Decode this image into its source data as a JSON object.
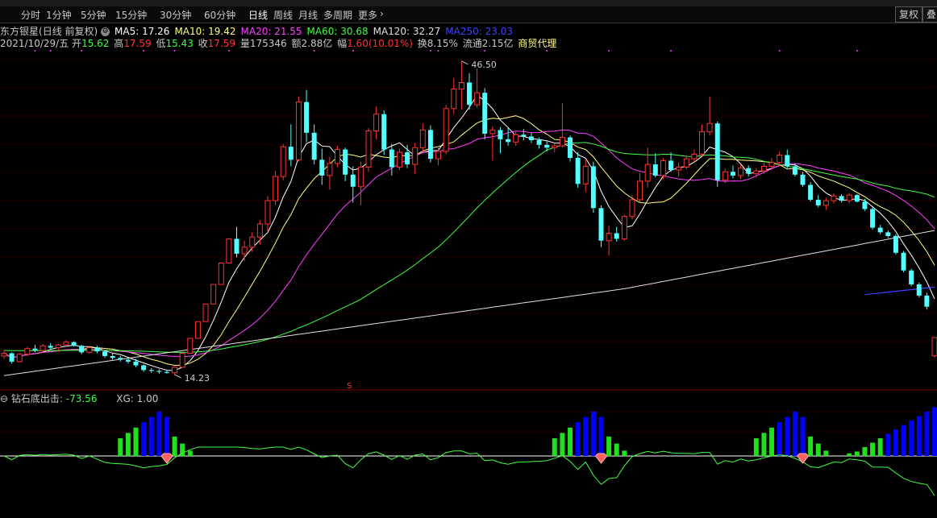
{
  "periods": [
    "分时",
    "1分钟",
    "5分钟",
    "15分钟",
    "30分钟",
    "60分钟",
    "日线",
    "周线",
    "月线",
    "多周期",
    "更多"
  ],
  "active_period": "日线",
  "more_arrow": "›",
  "right_buttons": {
    "fq": "复权",
    "overlay": "叠"
  },
  "stock": {
    "name": "东方银星",
    "mode": "(日线 前复权)"
  },
  "ma_labels": [
    {
      "text": "MA5: 17.26",
      "color": "#ffffff"
    },
    {
      "text": "MA10: 19.42",
      "color": "#ffff80"
    },
    {
      "text": "MA20: 21.55",
      "color": "#ff40ff"
    },
    {
      "text": "MA60: 30.68",
      "color": "#40ff40"
    },
    {
      "text": "MA120: 32.27",
      "color": "#e0e0e0"
    },
    {
      "text": "MA250: 23.03",
      "color": "#4040ff"
    }
  ],
  "ohlc": {
    "date": "2021/10/29/五",
    "open_label": "开",
    "open": "15.62",
    "high_label": "高",
    "high": "17.59",
    "low_label": "低",
    "low": "15.43",
    "close_label": "收",
    "close": "17.59",
    "vol_label": "量",
    "vol": "175346",
    "amt_label": "额",
    "amt": "2.88亿",
    "chg_label": "幅",
    "chg": "1.60(10.01%)",
    "turn_label": "换",
    "turn": "8.15%",
    "float_label": "流通",
    "float": "2.15亿",
    "industry": "商贸代理"
  },
  "annotations": {
    "high": "46.50",
    "low": "14.23",
    "s_marker": "S"
  },
  "sub": {
    "name": "钻石底出击",
    "value": ": -73.56",
    "xg": "XG: 1.00"
  },
  "colors": {
    "up": "#ff3232",
    "down": "#54ffff",
    "ma5": "#ffffff",
    "ma10": "#ffff80",
    "ma20": "#ff40ff",
    "ma60": "#40ff40",
    "ma120": "#e0e0e0",
    "ma250": "#4040ff"
  },
  "chart_data": {
    "type": "candlestick",
    "ylim": [
      13.0,
      48.5
    ],
    "candles": [
      [
        15.6,
        16.2,
        15.3,
        15.9
      ],
      [
        15.9,
        16.0,
        14.8,
        15.0
      ],
      [
        15.0,
        15.9,
        14.9,
        15.8
      ],
      [
        15.8,
        16.6,
        15.6,
        16.4
      ],
      [
        16.4,
        16.8,
        16.0,
        16.2
      ],
      [
        16.2,
        16.9,
        16.0,
        16.7
      ],
      [
        16.7,
        17.0,
        16.3,
        16.5
      ],
      [
        16.5,
        16.9,
        16.1,
        16.8
      ],
      [
        16.8,
        17.3,
        16.6,
        17.1
      ],
      [
        17.1,
        17.2,
        16.6,
        16.7
      ],
      [
        16.7,
        16.8,
        15.8,
        16.0
      ],
      [
        16.0,
        16.6,
        15.9,
        16.5
      ],
      [
        16.5,
        16.7,
        15.9,
        16.1
      ],
      [
        16.1,
        16.2,
        15.4,
        15.6
      ],
      [
        15.6,
        15.9,
        15.2,
        15.4
      ],
      [
        15.4,
        15.6,
        15.0,
        15.2
      ],
      [
        15.2,
        15.4,
        14.8,
        15.0
      ],
      [
        15.0,
        15.3,
        14.4,
        14.6
      ],
      [
        14.6,
        14.7,
        13.9,
        14.1
      ],
      [
        14.1,
        14.3,
        13.8,
        14.0
      ],
      [
        14.0,
        14.2,
        13.7,
        13.9
      ],
      [
        13.9,
        14.1,
        13.7,
        13.8
      ],
      [
        13.8,
        14.5,
        13.6,
        14.4
      ],
      [
        14.4,
        15.9,
        14.4,
        15.9
      ],
      [
        15.9,
        17.5,
        15.9,
        17.5
      ],
      [
        17.5,
        19.3,
        17.5,
        19.3
      ],
      [
        19.3,
        21.2,
        19.3,
        21.2
      ],
      [
        21.2,
        23.3,
        21.2,
        23.3
      ],
      [
        23.3,
        25.6,
        23.3,
        25.6
      ],
      [
        25.6,
        28.2,
        25.6,
        28.2
      ],
      [
        28.2,
        29.5,
        26.2,
        26.6
      ],
      [
        26.6,
        28.0,
        25.8,
        27.3
      ],
      [
        27.3,
        28.9,
        26.8,
        28.4
      ],
      [
        28.4,
        30.2,
        27.6,
        29.8
      ],
      [
        29.8,
        32.8,
        29.0,
        32.3
      ],
      [
        32.3,
        35.5,
        31.8,
        34.9
      ],
      [
        34.9,
        38.4,
        34.5,
        38.1
      ],
      [
        38.1,
        40.5,
        36.0,
        36.7
      ],
      [
        36.7,
        43.5,
        36.5,
        42.9
      ],
      [
        42.9,
        44.2,
        38.6,
        39.6
      ],
      [
        39.6,
        40.5,
        36.2,
        36.7
      ],
      [
        36.7,
        37.9,
        34.0,
        35.0
      ],
      [
        35.0,
        37.0,
        33.5,
        36.3
      ],
      [
        36.3,
        38.2,
        35.9,
        37.8
      ],
      [
        37.8,
        38.0,
        34.4,
        35.1
      ],
      [
        35.1,
        36.0,
        32.1,
        33.8
      ],
      [
        33.8,
        36.5,
        31.8,
        35.9
      ],
      [
        35.9,
        40.1,
        35.4,
        39.8
      ],
      [
        39.8,
        42.4,
        38.9,
        41.6
      ],
      [
        41.6,
        42.0,
        37.2,
        37.8
      ],
      [
        37.8,
        38.4,
        35.0,
        35.9
      ],
      [
        35.9,
        37.9,
        35.6,
        37.5
      ],
      [
        37.5,
        38.3,
        35.8,
        36.2
      ],
      [
        36.2,
        38.5,
        35.2,
        38.0
      ],
      [
        38.0,
        40.6,
        37.5,
        39.9
      ],
      [
        39.9,
        40.4,
        36.4,
        36.8
      ],
      [
        36.8,
        38.2,
        36.1,
        37.6
      ],
      [
        37.6,
        42.6,
        37.3,
        42.2
      ],
      [
        42.2,
        45.5,
        41.6,
        44.3
      ],
      [
        44.3,
        47.3,
        42.1,
        45.0
      ],
      [
        45.0,
        46.0,
        42.1,
        42.6
      ],
      [
        42.6,
        46.5,
        42.3,
        43.9
      ],
      [
        43.9,
        44.4,
        38.9,
        39.5
      ],
      [
        39.5,
        40.3,
        36.6,
        39.9
      ],
      [
        39.9,
        40.2,
        37.4,
        38.9
      ],
      [
        38.9,
        40.1,
        38.2,
        38.6
      ],
      [
        38.6,
        39.8,
        38.2,
        39.4
      ],
      [
        39.4,
        40.0,
        38.8,
        39.2
      ],
      [
        39.2,
        39.6,
        38.5,
        38.8
      ],
      [
        38.8,
        39.1,
        37.9,
        38.3
      ],
      [
        38.3,
        38.7,
        37.6,
        38.0
      ],
      [
        38.0,
        38.5,
        37.5,
        38.2
      ],
      [
        38.2,
        42.8,
        38.0,
        39.1
      ],
      [
        39.1,
        39.3,
        36.5,
        36.9
      ],
      [
        36.9,
        37.5,
        33.7,
        34.1
      ],
      [
        34.1,
        36.8,
        33.2,
        36.0
      ],
      [
        36.0,
        36.5,
        31.0,
        31.5
      ],
      [
        31.5,
        31.8,
        27.3,
        28.0
      ],
      [
        28.0,
        29.6,
        26.4,
        28.8
      ],
      [
        28.8,
        29.5,
        27.9,
        28.2
      ],
      [
        28.2,
        30.8,
        28.0,
        30.6
      ],
      [
        30.6,
        32.9,
        30.3,
        32.4
      ],
      [
        32.4,
        35.3,
        32.1,
        34.4
      ],
      [
        34.4,
        38.0,
        33.7,
        36.2
      ],
      [
        36.2,
        37.4,
        34.8,
        35.0
      ],
      [
        35.0,
        36.9,
        34.6,
        36.6
      ],
      [
        36.6,
        37.5,
        35.4,
        35.6
      ],
      [
        35.6,
        36.4,
        34.9,
        35.9
      ],
      [
        35.9,
        37.2,
        35.7,
        36.8
      ],
      [
        36.8,
        37.8,
        36.4,
        37.3
      ],
      [
        37.3,
        40.5,
        37.1,
        39.7
      ],
      [
        39.7,
        43.5,
        39.3,
        40.6
      ],
      [
        40.6,
        40.8,
        33.8,
        34.5
      ],
      [
        34.5,
        35.7,
        34.2,
        35.4
      ],
      [
        35.4,
        36.1,
        34.7,
        35.0
      ],
      [
        35.0,
        36.2,
        34.6,
        35.8
      ],
      [
        35.8,
        36.1,
        34.9,
        35.2
      ],
      [
        35.2,
        35.8,
        34.8,
        35.5
      ],
      [
        35.5,
        36.4,
        35.2,
        36.0
      ],
      [
        36.0,
        36.9,
        35.6,
        36.4
      ],
      [
        36.4,
        37.6,
        36.0,
        37.2
      ],
      [
        37.2,
        37.8,
        35.8,
        36.0
      ],
      [
        36.0,
        36.3,
        34.9,
        35.1
      ],
      [
        35.1,
        35.4,
        33.8,
        34.0
      ],
      [
        34.0,
        34.3,
        32.2,
        32.4
      ],
      [
        32.4,
        32.9,
        31.6,
        31.8
      ],
      [
        31.8,
        32.6,
        31.3,
        32.3
      ],
      [
        32.3,
        33.1,
        32.0,
        32.8
      ],
      [
        32.8,
        33.0,
        32.1,
        32.3
      ],
      [
        32.3,
        33.1,
        32.0,
        32.9
      ],
      [
        32.9,
        33.0,
        32.1,
        32.2
      ],
      [
        32.2,
        32.5,
        31.2,
        31.4
      ],
      [
        31.4,
        31.6,
        29.2,
        29.4
      ],
      [
        29.4,
        29.7,
        28.7,
        28.9
      ],
      [
        28.9,
        29.1,
        28.3,
        28.5
      ],
      [
        28.5,
        28.7,
        26.5,
        26.7
      ],
      [
        26.7,
        26.9,
        24.6,
        24.8
      ],
      [
        24.8,
        25.0,
        23.1,
        23.3
      ],
      [
        23.3,
        23.5,
        21.9,
        22.1
      ],
      [
        22.1,
        22.4,
        20.6,
        20.9
      ],
      [
        15.62,
        17.59,
        15.43,
        17.59
      ]
    ],
    "xg_signals": [
      21,
      77,
      103
    ],
    "sub_ylim": [
      -120,
      60
    ]
  }
}
